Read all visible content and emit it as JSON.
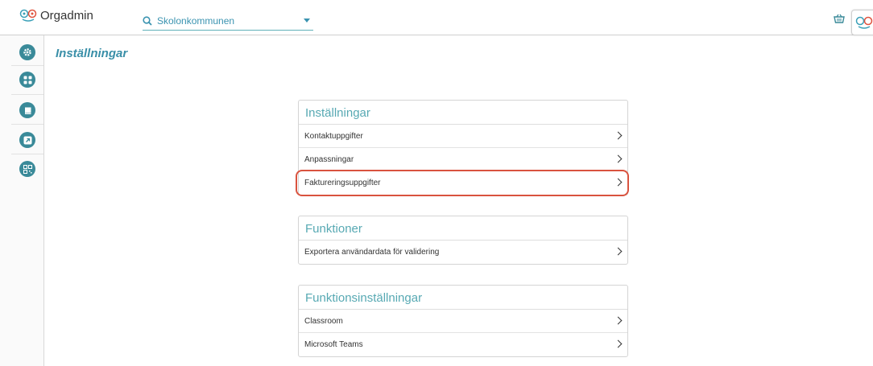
{
  "app": {
    "name": "Orgadmin"
  },
  "search": {
    "value": "Skolonkommunen"
  },
  "sidebar": {
    "items": [
      {
        "icon": "gear-icon"
      },
      {
        "icon": "grid-icon"
      },
      {
        "icon": "book-icon"
      },
      {
        "icon": "external-link-icon"
      },
      {
        "icon": "qr-code-icon"
      }
    ]
  },
  "page": {
    "title": "Inställningar"
  },
  "cards": [
    {
      "title": "Inställningar",
      "rows": [
        "Kontaktuppgifter",
        "Anpassningar",
        "Faktureringsuppgifter"
      ]
    },
    {
      "title": "Funktioner",
      "rows": [
        "Exportera användardata för validering"
      ]
    },
    {
      "title": "Funktionsinställningar",
      "rows": [
        "Classroom",
        "Microsoft Teams"
      ]
    }
  ],
  "colors": {
    "accent": "#3a8a99",
    "title": "#3a8fa8",
    "highlight": "#d9533f"
  }
}
